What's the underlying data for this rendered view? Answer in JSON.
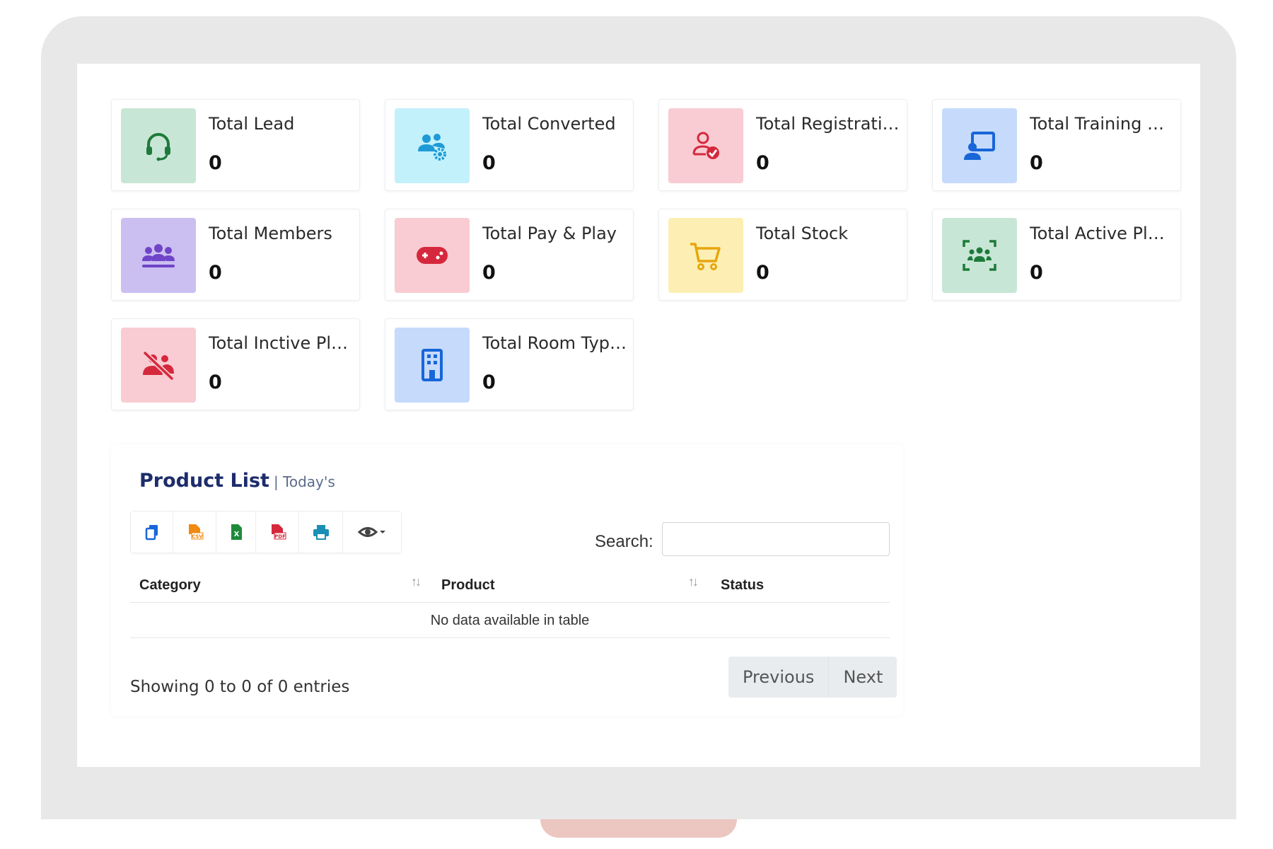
{
  "stats": {
    "cards": [
      {
        "label": "Total Lead",
        "value": "0",
        "icon": "headset-icon",
        "bg": "#c8e6d5",
        "fg": "#1e7a3a"
      },
      {
        "label": "Total Converted",
        "value": "0",
        "icon": "users-gear-icon",
        "bg": "#c3f1fb",
        "fg": "#1e9bd7"
      },
      {
        "label": "Total Registration",
        "value": "0",
        "icon": "user-check-icon",
        "bg": "#f8ccd2",
        "fg": "#d6283c"
      },
      {
        "label": "Total Training Class",
        "value": "0",
        "icon": "chalkboard-user-icon",
        "bg": "#c6dafc",
        "fg": "#1866d8"
      },
      {
        "label": "Total Members",
        "value": "0",
        "icon": "people-group-icon",
        "bg": "#cbbef0",
        "fg": "#6f44c9"
      },
      {
        "label": "Total Pay & Play",
        "value": "0",
        "icon": "gamepad-icon",
        "bg": "#f8ccd2",
        "fg": "#d6283c"
      },
      {
        "label": "Total Stock",
        "value": "0",
        "icon": "cart-icon",
        "bg": "#fdefb3",
        "fg": "#e6a60c"
      },
      {
        "label": "Total Active Players",
        "value": "0",
        "icon": "group-focus-icon",
        "bg": "#c8e6d5",
        "fg": "#1e7a3a"
      },
      {
        "label": "Total Inctive Players",
        "value": "0",
        "icon": "people-slash-icon",
        "bg": "#f8ccd2",
        "fg": "#d6283c"
      },
      {
        "label": "Total Room Types",
        "value": "0",
        "icon": "building-icon",
        "bg": "#c6dafc",
        "fg": "#1866d8"
      }
    ]
  },
  "product_list": {
    "title": "Product List",
    "subtitle": "| Today's",
    "toolbar": [
      {
        "name": "copy-icon",
        "color": "#1866d8"
      },
      {
        "name": "csv-icon",
        "color": "#f08a12"
      },
      {
        "name": "excel-icon",
        "color": "#1e8a3a"
      },
      {
        "name": "pdf-icon",
        "color": "#d6283c"
      },
      {
        "name": "print-icon",
        "color": "#1a8fb5"
      },
      {
        "name": "eye-icon",
        "color": "#444444"
      }
    ],
    "search_label": "Search:",
    "search_value": "",
    "columns": [
      "Category",
      "Product",
      "Status"
    ],
    "empty_message": "No data available in table",
    "showing": "Showing 0 to 0 of 0 entries",
    "prev_label": "Previous",
    "next_label": "Next"
  }
}
